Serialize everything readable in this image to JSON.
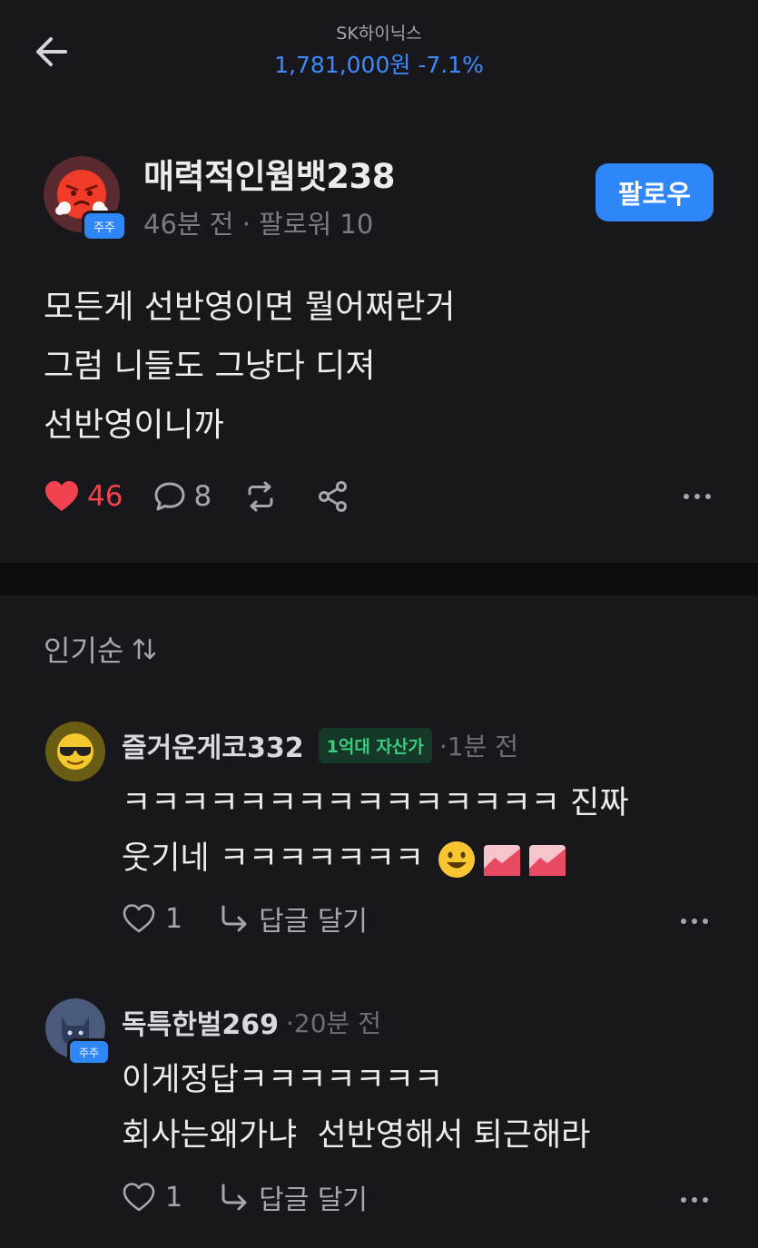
{
  "header": {
    "stock_name": "SK하이닉스",
    "price": "1,781,000원",
    "change": "-7.1%",
    "back_icon": "arrow-left-icon"
  },
  "post": {
    "author": "매력적인웜뱃238",
    "badge": "주주",
    "time": "46분 전",
    "followers": "팔로워 10",
    "follow_label": "팔로우",
    "lines": [
      "모든게 선반영이면 뭘어쩌란거",
      "그럼 니들도 그냥다 디져",
      "선반영이니까"
    ],
    "likes": "46",
    "comments": "8"
  },
  "sort": {
    "label": "인기순"
  },
  "comments": [
    {
      "name": "즐거운게코332",
      "tag": "1억대 자산가",
      "time": "·1분 전",
      "lines": [
        "ㅋㅋㅋㅋㅋㅋㅋㅋㅋㅋㅋㅋㅋㅋㅋ 진짜",
        "웃기네 ㅋㅋㅋㅋㅋㅋㅋ"
      ],
      "likes": "1",
      "reply_label": "답글 달기"
    },
    {
      "name": "독특한벌269",
      "badge": "주주",
      "time": "·20분 전",
      "lines": [
        "이게정답ㅋㅋㅋㅋㅋㅋㅋ",
        "회사는왜가냐  선반영해서 퇴근해라"
      ],
      "likes": "1",
      "reply_label": "답글 달기"
    }
  ],
  "colors": {
    "background": "#17171c",
    "accent": "#2f86f6",
    "like": "#f0424f",
    "price": "#3d8bff",
    "tag": "#3ccb7f"
  }
}
